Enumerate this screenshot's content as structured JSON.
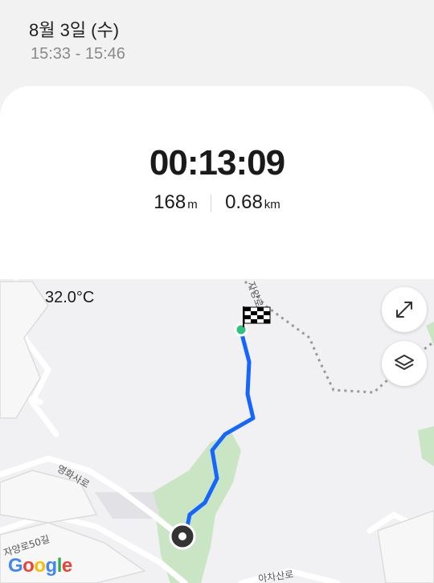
{
  "header": {
    "date": "8월 3일 (수)",
    "time_range": "15:33 - 15:46"
  },
  "summary": {
    "duration": "00:13:09",
    "elevation_value": "168",
    "elevation_unit": "m",
    "distance_value": "0.68",
    "distance_unit": "km"
  },
  "map": {
    "temperature": "32.0°C",
    "road_labels": [
      "영화사로",
      "자양로50길",
      "아차산로",
      "자양로"
    ],
    "attribution": {
      "G": "G",
      "o1": "o",
      "o2": "o",
      "g": "g",
      "l": "l",
      "e": "e"
    },
    "route_color": "#1565ff",
    "controls": {
      "expand_icon": "expand-arrows-icon",
      "layers_icon": "layers-icon"
    }
  }
}
